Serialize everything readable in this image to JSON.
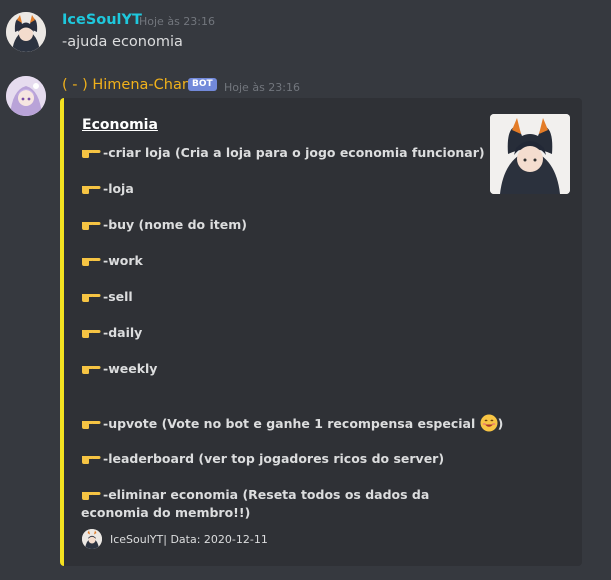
{
  "messages": [
    {
      "username": "IceSoulYT",
      "timestamp": "Hoje às 23:16",
      "text": "-ajuda economia"
    },
    {
      "username": "( - ) Himena-Chan",
      "bot_badge": "BOT",
      "timestamp": "Hoje às 23:16",
      "embed": {
        "title": "Economia",
        "accent_color": "#f4e120",
        "lines": [
          "-criar loja (Cria a loja para o jogo economia funcionar)",
          "-loja",
          "-buy (nome do item)",
          "-work",
          "-sell",
          "-daily",
          "-weekly",
          "-upvote (Vote no bot e ganhe 1 recompensa especial",
          ")",
          "-leaderboard (ver top jogadores ricos do server)",
          "-eliminar economia (Reseta todos os dados da economia do membro!!)"
        ],
        "footer": "IceSoulYT| Data: 2020-12-11"
      }
    }
  ],
  "colors": {
    "background": "#36393f",
    "embed_bg": "#2f3136",
    "username_user": "#1ec8dd",
    "username_bot": "#f1b11b",
    "bot_badge": "#7289da"
  },
  "icons": [
    "user-avatar",
    "bot-avatar",
    "pointing-hand-emoji",
    "smiling-face-emoji",
    "embed-thumbnail",
    "footer-avatar"
  ]
}
